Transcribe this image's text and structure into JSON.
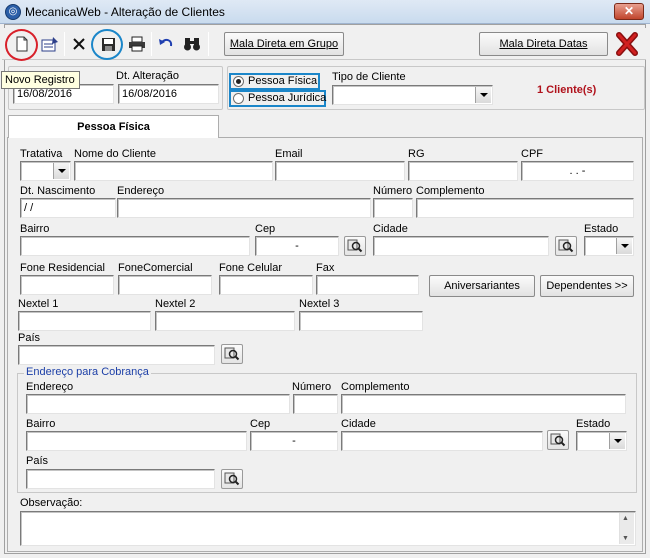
{
  "window": {
    "title": "MecanicaWeb - Alteração de Clientes",
    "close_glyph": "✕",
    "app_icon": "mecanicaweb-logo-icon"
  },
  "toolbar": {
    "icons": [
      "new-record-icon",
      "edit-form-icon",
      "delete-icon",
      "save-icon",
      "print-icon",
      "undo-icon",
      "binoculars-icon"
    ],
    "mala_grupo_label": "Mala Direta em Grupo",
    "mala_datas_label": "Mala Direta Datas",
    "exit_icon": "red-x-exit-icon"
  },
  "tooltip": "Novo Registro",
  "header": {
    "dt_cadastro_value": "16/08/2016",
    "dt_alteracao_label": "Dt. Alteração",
    "dt_alteracao_value": "16/08/2016",
    "pessoa_fisica_label": "Pessoa Física",
    "pessoa_juridica_label": "Pessoa Jurídica",
    "selected_pessoa": "fisica",
    "tipo_cliente_label": "Tipo de Cliente",
    "tipo_cliente_value": "",
    "client_count": "1 Cliente(s)"
  },
  "tab": {
    "label": "Pessoa Física"
  },
  "form": {
    "tratativa_label": "Tratativa",
    "nome_label": "Nome do Cliente",
    "email_label": "Email",
    "rg_label": "RG",
    "cpf_label": "CPF",
    "cpf_value": ".   .   -",
    "dt_nasc_label": "Dt. Nascimento",
    "dt_nasc_value": "/ /",
    "endereco_label": "Endereço",
    "numero_label": "Número",
    "complemento_label": "Complemento",
    "bairro_label": "Bairro",
    "cep_label": "Cep",
    "cep_value": "-",
    "cidade_label": "Cidade",
    "estado_label": "Estado",
    "fone_res_label": "Fone Residencial",
    "fone_com_label": "FoneComercial",
    "fone_cel_label": "Fone Celular",
    "fax_label": "Fax",
    "aniversariantes_label": "Aniversariantes",
    "dependentes_label": "Dependentes >>",
    "nextel1_label": "Nextel 1",
    "nextel2_label": "Nextel 2",
    "nextel3_label": "Nextel 3",
    "pais_label": "País"
  },
  "cobranca": {
    "legend": "Endereço para Cobrança",
    "endereco_label": "Endereço",
    "numero_label": "Número",
    "complemento_label": "Complemento",
    "bairro_label": "Bairro",
    "cep_label": "Cep",
    "cep_value": "-",
    "cidade_label": "Cidade",
    "estado_label": "Estado",
    "pais_label": "País"
  },
  "observacao_label": "Observação:",
  "colors": {
    "highlight_red": "#d8202a",
    "highlight_blue": "#1b86c9",
    "count_red": "#b0121c",
    "legend_blue": "#1c3fa7"
  }
}
